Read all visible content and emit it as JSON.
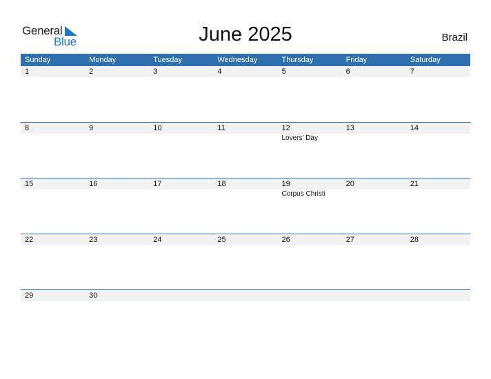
{
  "logo": {
    "line1": "General",
    "line2": "Blue"
  },
  "title": "June 2025",
  "country": "Brazil",
  "colors": {
    "header": "#2e6fad",
    "date_row": "#f2f2f2",
    "logo_blue": "#1e7bc4"
  },
  "weekdays": [
    "Sunday",
    "Monday",
    "Tuesday",
    "Wednesday",
    "Thursday",
    "Friday",
    "Saturday"
  ],
  "weeks": [
    {
      "days": [
        "1",
        "2",
        "3",
        "4",
        "5",
        "6",
        "7"
      ],
      "events": [
        "",
        "",
        "",
        "",
        "",
        "",
        ""
      ]
    },
    {
      "days": [
        "8",
        "9",
        "10",
        "11",
        "12",
        "13",
        "14"
      ],
      "events": [
        "",
        "",
        "",
        "",
        "Lovers' Day",
        "",
        ""
      ]
    },
    {
      "days": [
        "15",
        "16",
        "17",
        "18",
        "19",
        "20",
        "21"
      ],
      "events": [
        "",
        "",
        "",
        "",
        "Corpus Christi",
        "",
        ""
      ]
    },
    {
      "days": [
        "22",
        "23",
        "24",
        "25",
        "26",
        "27",
        "28"
      ],
      "events": [
        "",
        "",
        "",
        "",
        "",
        "",
        ""
      ]
    },
    {
      "days": [
        "29",
        "30",
        "",
        "",
        "",
        "",
        ""
      ],
      "events": [
        "",
        "",
        "",
        "",
        "",
        "",
        ""
      ]
    }
  ]
}
